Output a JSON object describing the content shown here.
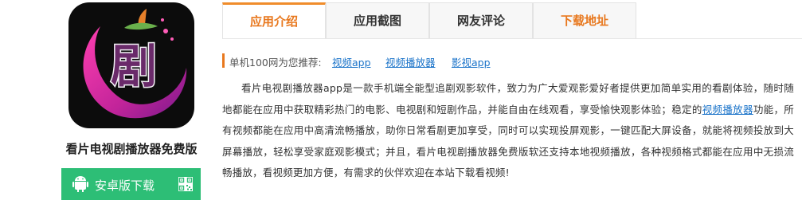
{
  "app": {
    "icon_glyph": "剧",
    "title": "看片电视剧播放器免费版",
    "download_label": "安卓版下载"
  },
  "tabs": [
    {
      "label": "应用介绍",
      "active": true
    },
    {
      "label": "应用截图",
      "active": false
    },
    {
      "label": "网友评论",
      "active": false
    },
    {
      "label": "下载地址",
      "active": false
    }
  ],
  "recommend": {
    "label": "单机100网为您推荐:",
    "links": [
      "视频app",
      "视频播放器",
      "影视app"
    ]
  },
  "description": {
    "part1": "看片电视剧播放器app是一款手机端全能型追剧观影软件，致力为广大爱观影爱好者提供更加简单实用的看剧体验，随时随地都能在应用中获取精彩热门的电影、电视剧和短剧作品，并能自由在线观看，享受愉快观影体验；稳定的",
    "link": "视频播放器",
    "part2": "功能，所有视频都能在应用中高清流畅播放，助你日常看剧更加享受，同时可以实现投屏观影，一键匹配大屏设备，就能将视频投放到大屏幕播放，轻松享受家庭观影模式；并且，看片电视剧播放器免费版软还支持本地视频播放，各种视频格式都能在应用中无损流畅播放，看视频更加方便，有需求的伙伴欢迎在本站下载看视频!"
  },
  "colors": {
    "accent_orange": "#e8781e",
    "download_green": "#2dbe76",
    "link_blue": "#1a73c9"
  }
}
